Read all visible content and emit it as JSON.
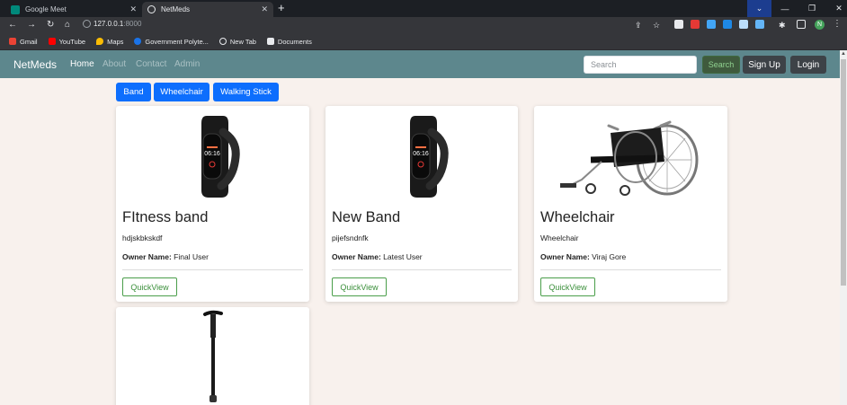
{
  "browser": {
    "tabs": [
      {
        "title": "Google Meet",
        "active": false
      },
      {
        "title": "NetMeds",
        "active": true
      }
    ],
    "address": {
      "host": "127.0.0.1",
      "port": ":8000"
    },
    "bookmarks": [
      "Gmail",
      "YouTube",
      "Maps",
      "Government Polyte...",
      "New Tab",
      "Documents"
    ],
    "profile_initial": "N"
  },
  "site": {
    "brand": "NetMeds",
    "nav": [
      "Home",
      "About",
      "Contact",
      "Admin"
    ],
    "search_placeholder": "Search",
    "search_button": "Search",
    "signup": "Sign Up",
    "login": "Login"
  },
  "categories": [
    "Band",
    "Wheelchair",
    "Walking Stick"
  ],
  "products": [
    {
      "name": "FItness band",
      "desc": "hdjskbkskdf",
      "owner_label": "Owner Name:",
      "owner": "Final User",
      "button": "QuickView",
      "watch_time": "06:16"
    },
    {
      "name": "New Band",
      "desc": "pijefsndnfk",
      "owner_label": "Owner Name:",
      "owner": "Latest User",
      "button": "QuickView",
      "watch_time": "06:16"
    },
    {
      "name": "Wheelchair",
      "desc": "Wheelchair",
      "owner_label": "Owner Name:",
      "owner": "Viraj Gore",
      "button": "QuickView"
    }
  ],
  "colors": {
    "navbar": "#5d878d",
    "page_bg": "#f8f1ed",
    "primary": "#0d6efd",
    "quickview": "#3a8f3a"
  }
}
